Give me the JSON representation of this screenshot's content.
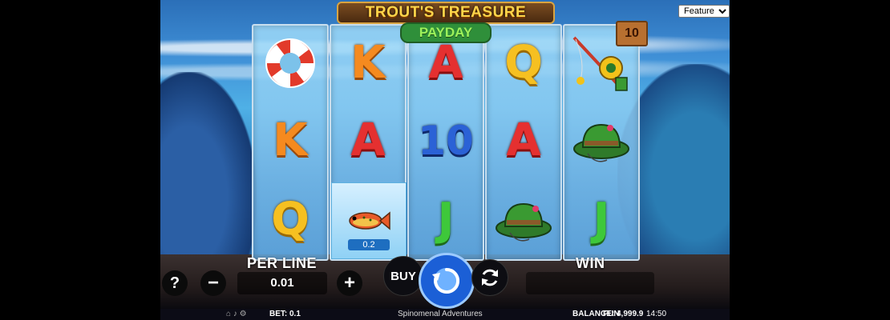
{
  "game": {
    "title": "TROUT'S TREASURE",
    "subtitle": "PAYDAY"
  },
  "features_dropdown": {
    "options": [
      "Features"
    ],
    "selected": "Features"
  },
  "multiplier": "10",
  "reels": [
    [
      "lifebuoy",
      "K",
      "Q"
    ],
    [
      "K",
      "A",
      "fish"
    ],
    [
      "A",
      "10",
      "J"
    ],
    [
      "Q",
      "A",
      "fishing-hat"
    ],
    [
      "fishing-rod",
      "fishing-hat",
      "J"
    ]
  ],
  "highlighted_symbol": {
    "value": "0.2"
  },
  "controls": {
    "per_line_label": "PER LINE",
    "per_line_value": "0.01",
    "win_label": "WIN",
    "help": "?",
    "minus": "−",
    "plus": "+",
    "buy": "BUY"
  },
  "status": {
    "bet": "BET: 0.1",
    "provider": "Spinomenal Adventures",
    "balance": "BALANCE: 4,999.9",
    "mode": "FUN",
    "time": "14:50"
  },
  "colors": {
    "reel_bg": "#9fd9f7",
    "spin_button": "#1b5fd6",
    "accent_gold": "#ffd54a"
  }
}
